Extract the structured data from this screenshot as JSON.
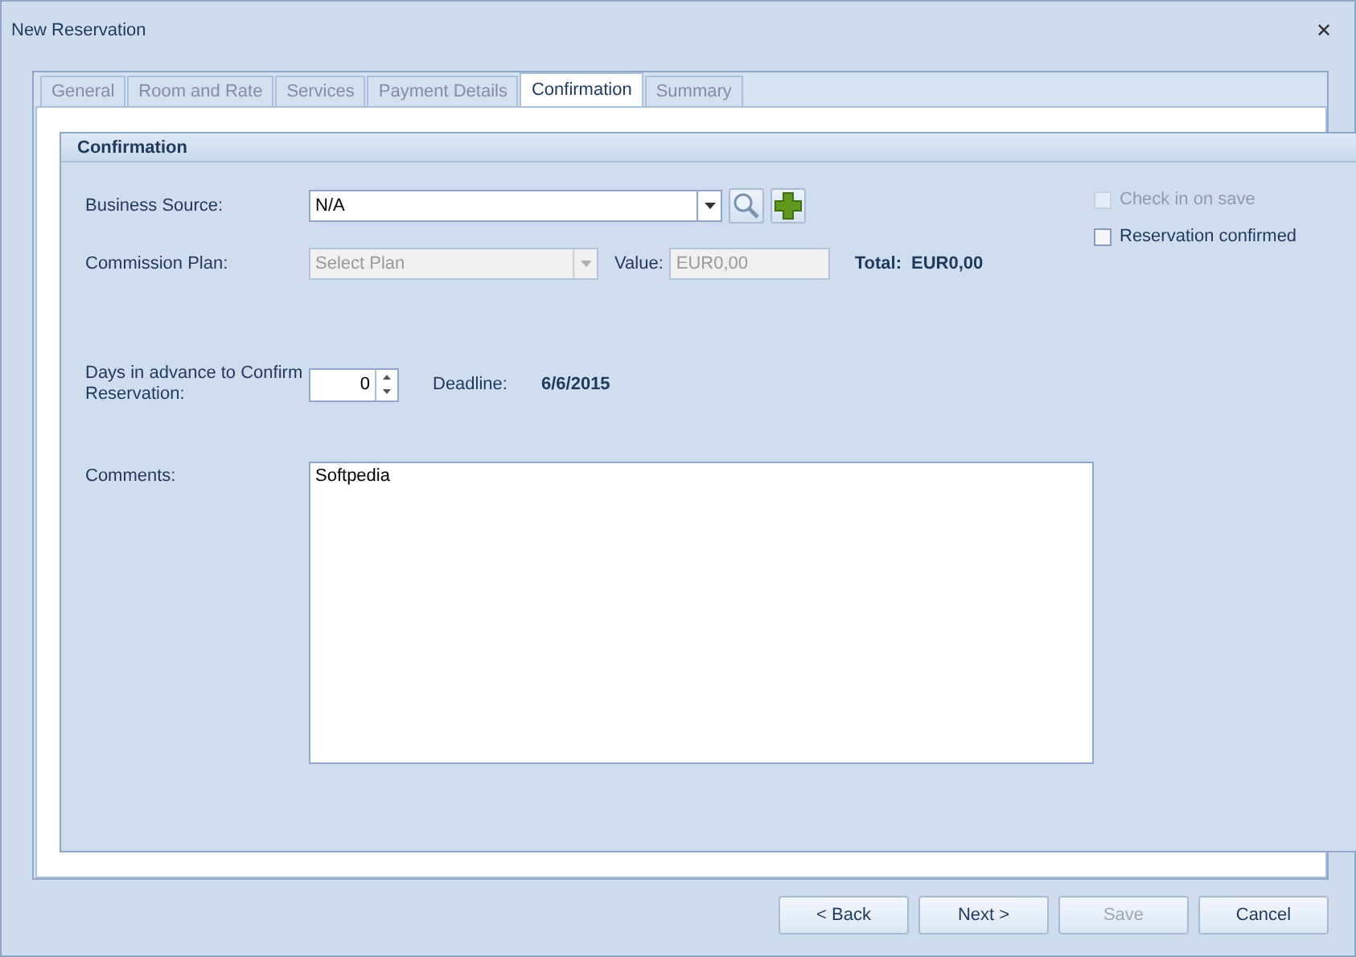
{
  "window": {
    "title": "New Reservation",
    "close": "✕"
  },
  "tabs": [
    {
      "label": "General",
      "selected": false
    },
    {
      "label": "Room and Rate",
      "selected": false
    },
    {
      "label": "Services",
      "selected": false
    },
    {
      "label": "Payment Details",
      "selected": false
    },
    {
      "label": "Confirmation",
      "selected": true
    },
    {
      "label": "Summary",
      "selected": false
    }
  ],
  "section": {
    "title": "Confirmation"
  },
  "business_source": {
    "label": "Business Source:",
    "value": "N/A"
  },
  "commission_plan": {
    "label": "Commission Plan:",
    "placeholder": "Select Plan",
    "disabled": true,
    "value_label": "Value:",
    "value": "EUR0,00",
    "total_label": "Total:",
    "total": "EUR0,00"
  },
  "days_in_advance": {
    "label": "Days in advance to Confirm Reservation:",
    "value": "0",
    "deadline_label": "Deadline:",
    "deadline": "6/6/2015"
  },
  "comments": {
    "label": "Comments:",
    "value": "Softpedia"
  },
  "checkboxes": [
    {
      "label": "Check in on save",
      "checked": false,
      "disabled": true
    },
    {
      "label": "Reservation confirmed",
      "checked": false,
      "disabled": false
    }
  ],
  "buttons": [
    {
      "label": "< Back",
      "disabled": false
    },
    {
      "label": "Next >",
      "disabled": false
    },
    {
      "label": "Save",
      "disabled": true
    },
    {
      "label": "Cancel",
      "disabled": false
    }
  ]
}
